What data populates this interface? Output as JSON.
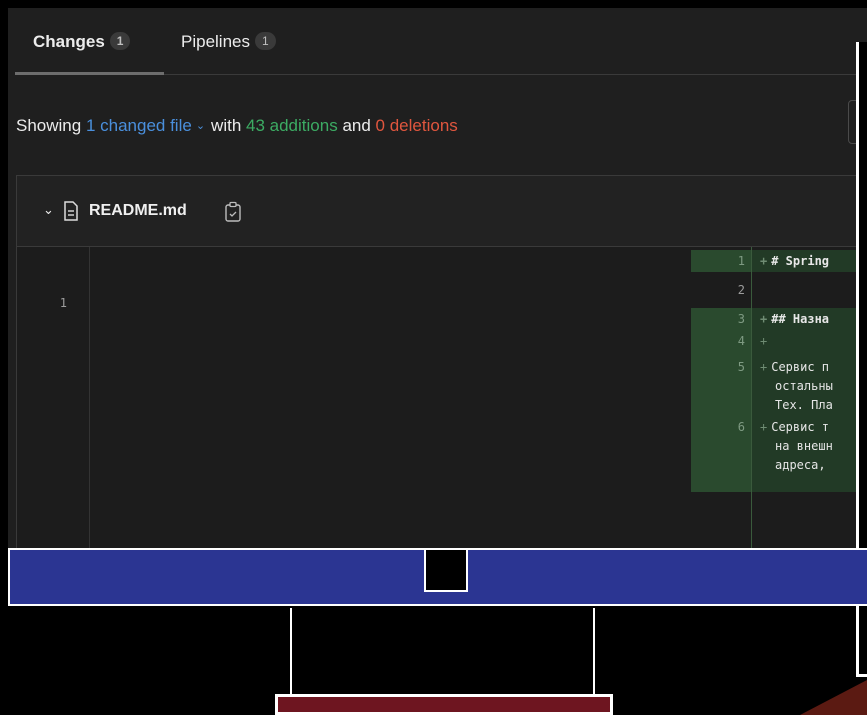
{
  "tabs": [
    {
      "label": "Changes",
      "count": "1"
    },
    {
      "label": "Pipelines",
      "count": "1"
    }
  ],
  "summary": {
    "showing": "Showing",
    "changed_file": "1 changed file",
    "with": "with",
    "additions": "43 additions",
    "and": "and",
    "deletions": "0 deletions"
  },
  "file": {
    "name": "README.md",
    "left_line_numbers": [
      "1"
    ],
    "right_lines": [
      {
        "num": "1",
        "text": "# Spring",
        "added": true
      },
      {
        "num": "2",
        "text": "",
        "added": false
      },
      {
        "num": "3",
        "text": "## Назна",
        "added": true
      },
      {
        "num": "4",
        "text": "",
        "added": true
      },
      {
        "num": "5",
        "text": "Сервис п",
        "cont": [
          "остальны",
          "Тех. Пла"
        ],
        "added": true
      },
      {
        "num": "6",
        "text": "Сервис т",
        "cont": [
          "на внешн",
          "адреса,"
        ],
        "added": true
      }
    ]
  },
  "colors": {
    "blue": "#4a8fdc",
    "green": "#3cab63",
    "red": "#e0563e",
    "taskbar": "#2b3592",
    "stand_base": "#6e1520"
  }
}
